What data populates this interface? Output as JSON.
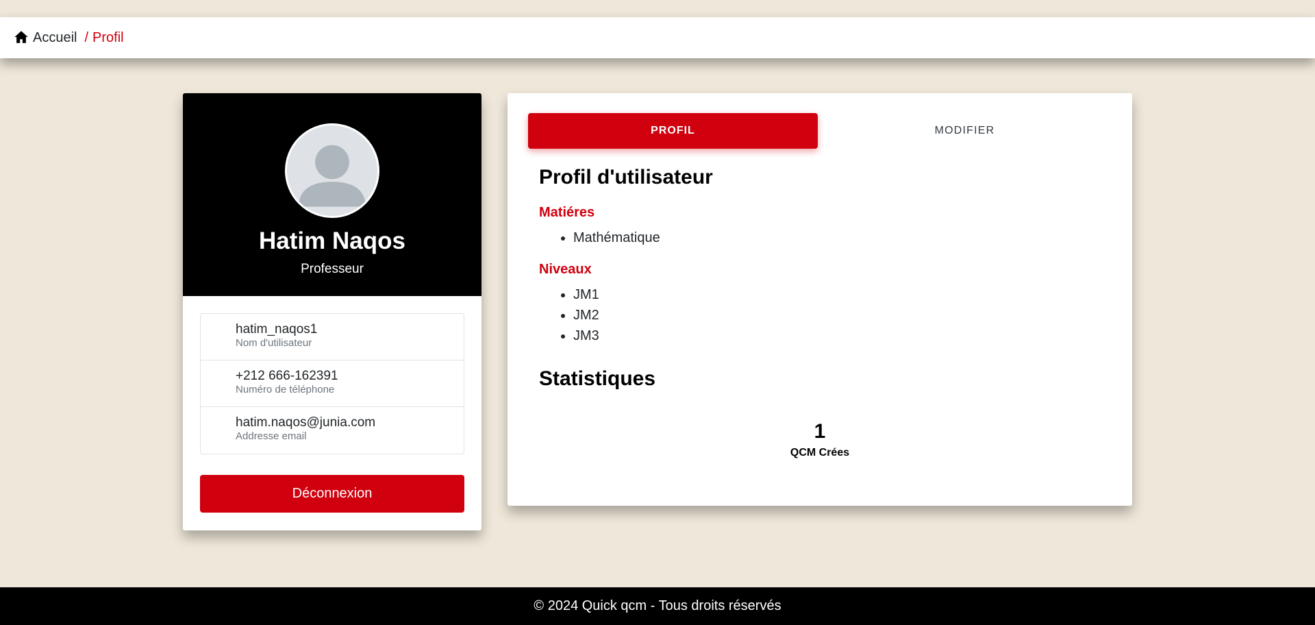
{
  "breadcrumb": {
    "home_icon": "home-icon",
    "home_label": "Accueil",
    "separator": "/",
    "current": "Profil"
  },
  "profile": {
    "avatar_icon": "user-avatar-icon",
    "name": "Hatim Naqos",
    "role": "Professeur",
    "info": [
      {
        "value": "hatim_naqos1",
        "label": "Nom d'utilisateur"
      },
      {
        "value": "+212 666-162391",
        "label": "Numéro de téléphone"
      },
      {
        "value": "hatim.naqos@junia.com",
        "label": "Addresse email"
      }
    ],
    "logout_label": "Déconnexion"
  },
  "tabs": [
    {
      "label": "PROFIL",
      "active": true
    },
    {
      "label": "MODIFIER",
      "active": false
    }
  ],
  "details": {
    "title": "Profil d'utilisateur",
    "subjects_heading": "Matiéres",
    "subjects": [
      "Mathématique"
    ],
    "levels_heading": "Niveaux",
    "levels": [
      "JM1",
      "JM2",
      "JM3"
    ],
    "stats_title": "Statistiques",
    "stats": [
      {
        "value": "1",
        "label": "QCM Crées"
      }
    ]
  },
  "footer": {
    "text": "© 2024 Quick qcm - Tous droits réservés"
  },
  "colors": {
    "accent": "#d0000f",
    "background": "#efe8da",
    "header": "#000000"
  }
}
